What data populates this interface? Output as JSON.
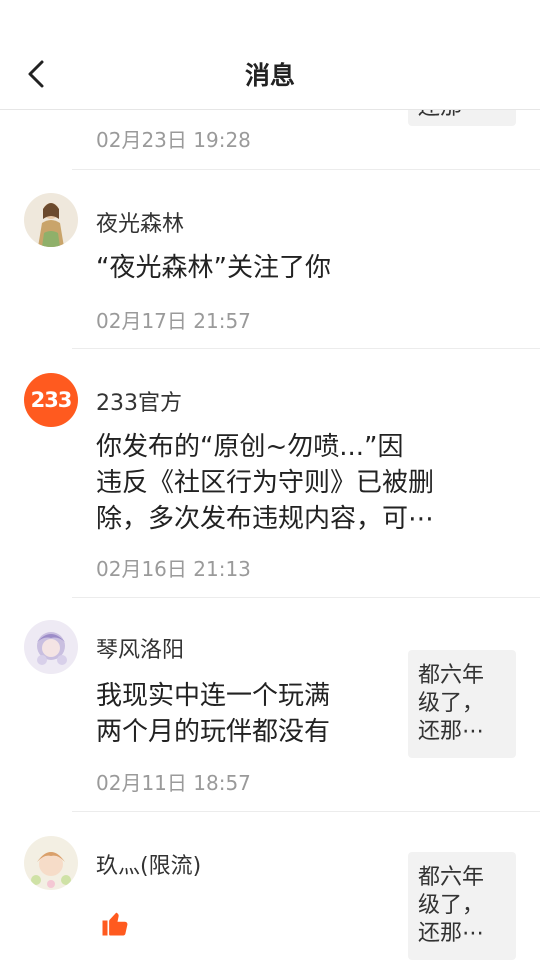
{
  "header": {
    "title": "消息"
  },
  "first_item": {
    "quote": "还那",
    "time": "02月23日 19:28"
  },
  "messages": [
    {
      "username": "夜光森林",
      "text": "“夜光森林”关注了你",
      "time": "02月17日 21:57"
    },
    {
      "username": "233官方",
      "avatar_text": "233",
      "text_line1": "你发布的“原创~勿喷...”因",
      "text_line2": "违反《社区行为守则》已被删",
      "text_line3": "除，多次发布违规内容，可⋯",
      "time": "02月16日 21:13"
    },
    {
      "username": "琴风洛阳",
      "text_line1": "我现实中连一个玩满",
      "text_line2": "两个月的玩伴都没有",
      "time": "02月11日 18:57",
      "quote_line1": "都六年",
      "quote_line2": "级了，",
      "quote_line3": "还那⋯"
    },
    {
      "username": "玖灬(限流)",
      "quote_line1": "都六年",
      "quote_line2": "级了，",
      "quote_line3": "还那⋯"
    }
  ],
  "colors": {
    "accent": "#ff5a1f",
    "text": "#222222",
    "secondary": "#9a9a9a",
    "quote_bg": "#f2f2f2"
  }
}
